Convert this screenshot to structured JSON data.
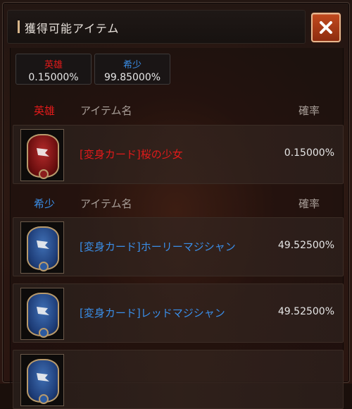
{
  "header": {
    "title": "獲得可能アイテム"
  },
  "summary": [
    {
      "label": "英雄",
      "value": "0.15000%",
      "color": "#e21a1a"
    },
    {
      "label": "希少",
      "value": "99.85000%",
      "color": "#3a8ee8"
    }
  ],
  "sections": {
    "hero": {
      "grade": "英雄",
      "col_name": "アイテム名",
      "col_rate": "確率",
      "items": [
        {
          "name": "[変身カード]桜の少女",
          "rate": "0.15000%",
          "icon": "red-card-icon"
        }
      ]
    },
    "rare": {
      "grade": "希少",
      "col_name": "アイテム名",
      "col_rate": "確率",
      "items": [
        {
          "name": "[変身カード]ホーリーマジシャン",
          "rate": "49.52500%",
          "icon": "blue-card-icon"
        },
        {
          "name": "[変身カード]レッドマジシャン",
          "rate": "49.52500%",
          "icon": "blue-card-icon"
        },
        {
          "name": "",
          "rate": "",
          "icon": "blue-card-icon"
        }
      ]
    }
  },
  "colors": {
    "hero": "#e21a1a",
    "rare": "#3a8ee8",
    "close_button": "#b23c17"
  }
}
